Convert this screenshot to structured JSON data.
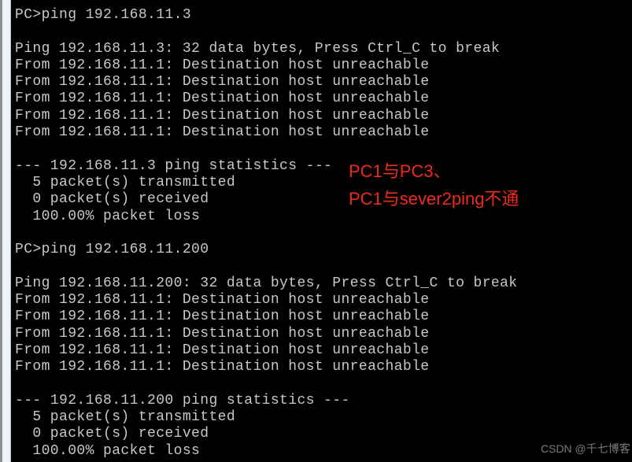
{
  "terminal": {
    "lines": [
      "PC>ping 192.168.11.3",
      "",
      "Ping 192.168.11.3: 32 data bytes, Press Ctrl_C to break",
      "From 192.168.11.1: Destination host unreachable",
      "From 192.168.11.1: Destination host unreachable",
      "From 192.168.11.1: Destination host unreachable",
      "From 192.168.11.1: Destination host unreachable",
      "From 192.168.11.1: Destination host unreachable",
      "",
      "--- 192.168.11.3 ping statistics ---",
      "  5 packet(s) transmitted",
      "  0 packet(s) received",
      "  100.00% packet loss",
      "",
      "PC>ping 192.168.11.200",
      "",
      "Ping 192.168.11.200: 32 data bytes, Press Ctrl_C to break",
      "From 192.168.11.1: Destination host unreachable",
      "From 192.168.11.1: Destination host unreachable",
      "From 192.168.11.1: Destination host unreachable",
      "From 192.168.11.1: Destination host unreachable",
      "From 192.168.11.1: Destination host unreachable",
      "",
      "--- 192.168.11.200 ping statistics ---",
      "  5 packet(s) transmitted",
      "  0 packet(s) received",
      "  100.00% packet loss"
    ]
  },
  "annotation": {
    "line1": "PC1与PC3、",
    "line2": "PC1与sever2ping不通",
    "color": "#ee2a1b"
  },
  "watermark": "CSDN @千七博客"
}
